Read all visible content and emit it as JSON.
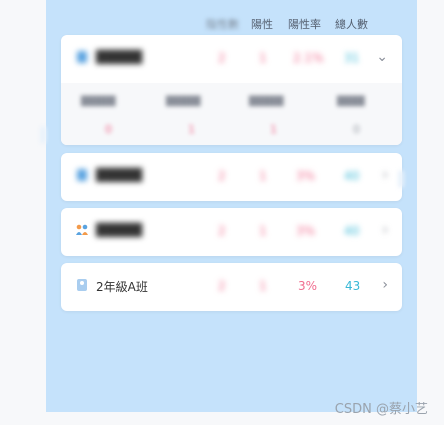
{
  "header": {
    "col_blurred": "陰性數",
    "col_positive": "陽性",
    "col_rate": "陽性率",
    "col_total": "總人數"
  },
  "cards": [
    {
      "icon": "person-icon",
      "name": "█████",
      "blurred": true,
      "negative": "2",
      "positive": "1",
      "rate": "2.1%",
      "total": "31",
      "expanded": true,
      "details": [
        {
          "label": "█████",
          "value": "0"
        },
        {
          "label": "█████",
          "value": "1"
        },
        {
          "label": "█████",
          "value": "1"
        },
        {
          "label": "████",
          "value": "0"
        }
      ]
    },
    {
      "icon": "person-icon",
      "name": "█████",
      "blurred": true,
      "negative": "2",
      "positive": "1",
      "rate": "3%",
      "total": "40",
      "expanded": false
    },
    {
      "icon": "group-icon",
      "name": "█████",
      "blurred": true,
      "negative": "2",
      "positive": "1",
      "rate": "3%",
      "total": "40",
      "expanded": false
    },
    {
      "icon": "person-icon",
      "name": "2年級A班",
      "blurred": false,
      "negative": "2",
      "positive": "1",
      "rate": "3%",
      "total": "43",
      "expanded": false
    }
  ],
  "watermark": "CSDN @蔡小艺"
}
